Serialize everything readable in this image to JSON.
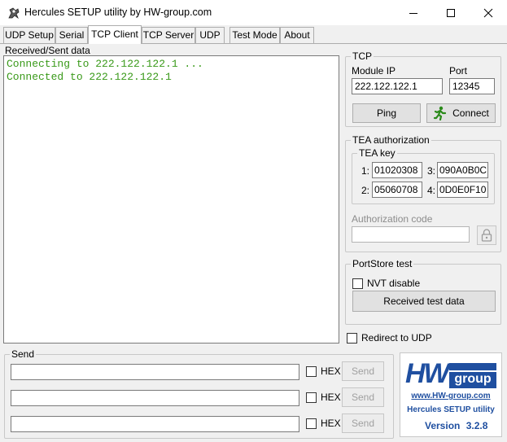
{
  "window": {
    "title": "Hercules SETUP utility by HW-group.com"
  },
  "tabs": [
    {
      "label": "UDP Setup"
    },
    {
      "label": "Serial"
    },
    {
      "label": "TCP Client"
    },
    {
      "label": "TCP Server"
    },
    {
      "label": "UDP"
    },
    {
      "label": "Test Mode"
    },
    {
      "label": "About"
    }
  ],
  "received": {
    "label": "Received/Sent data",
    "lines": [
      "Connecting to 222.122.122.1 ...",
      "Connected to 222.122.122.1"
    ],
    "text_color": "#3a9a1a"
  },
  "tcp": {
    "group_title": "TCP",
    "module_ip_label": "Module IP",
    "module_ip_value": "222.122.122.1",
    "port_label": "Port",
    "port_value": "12345",
    "ping_label": "Ping",
    "connect_label": "Connect"
  },
  "tea": {
    "group_title": "TEA authorization",
    "key_group_title": "TEA key",
    "keys": [
      {
        "index": "1:",
        "value": "01020308"
      },
      {
        "index": "3:",
        "value": "090A0B0C"
      },
      {
        "index": "2:",
        "value": "05060708"
      },
      {
        "index": "4:",
        "value": "0D0E0F10"
      }
    ],
    "auth_code_label": "Authorization code",
    "auth_code_value": ""
  },
  "portstore": {
    "group_title": "PortStore test",
    "nvt_disable_label": "NVT disable",
    "nvt_disable_checked": false,
    "received_test_data_label": "Received test data"
  },
  "redirect": {
    "label": "Redirect to UDP",
    "checked": false
  },
  "send": {
    "group_title": "Send",
    "rows": [
      {
        "value": "",
        "hex_label": "HEX",
        "hex_checked": false,
        "send_label": "Send"
      },
      {
        "value": "",
        "hex_label": "HEX",
        "hex_checked": false,
        "send_label": "Send"
      },
      {
        "value": "",
        "hex_label": "HEX",
        "hex_checked": false,
        "send_label": "Send"
      }
    ]
  },
  "logo": {
    "brand_hw": "HW",
    "brand_group": "group",
    "url": "www.HW-group.com",
    "product": "Hercules SETUP utility",
    "version_label": "Version",
    "version_number": "3.2.8",
    "brand_color": "#1f4fa0"
  }
}
